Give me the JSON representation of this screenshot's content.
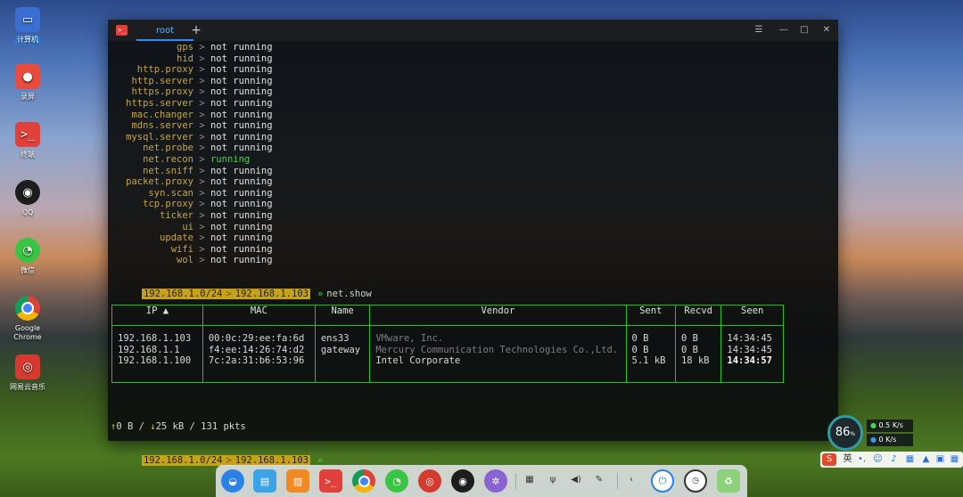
{
  "desktop": {
    "icons": [
      {
        "label": "计算机",
        "icon": "computer-icon",
        "color": "#3a6fd2"
      },
      {
        "label": "录屏",
        "icon": "screen-recorder-icon",
        "color": "#e94b3c"
      },
      {
        "label": "终端",
        "icon": "terminal-icon",
        "color": "#e0413a"
      },
      {
        "label": "QQ",
        "icon": "qq-penguin-icon",
        "color": "#1d1d1d"
      },
      {
        "label": "微信",
        "icon": "wechat-icon",
        "color": "#39c443"
      },
      {
        "label": "Google Chrome",
        "icon": "chrome-icon",
        "color": "#db4437"
      },
      {
        "label": "网易云音乐",
        "icon": "netease-music-icon",
        "color": "#d53a2f"
      }
    ]
  },
  "window": {
    "tab_label": "root",
    "new_tab_symbol": "+",
    "controls": {
      "menu": "☰",
      "minimize": "—",
      "maximize": "□",
      "close": "✕"
    }
  },
  "terminal": {
    "modules": [
      {
        "name": "gps",
        "status": "not running"
      },
      {
        "name": "hid",
        "status": "not running"
      },
      {
        "name": "http.proxy",
        "status": "not running"
      },
      {
        "name": "http.server",
        "status": "not running"
      },
      {
        "name": "https.proxy",
        "status": "not running"
      },
      {
        "name": "https.server",
        "status": "not running"
      },
      {
        "name": "mac.changer",
        "status": "not running"
      },
      {
        "name": "mdns.server",
        "status": "not running"
      },
      {
        "name": "mysql.server",
        "status": "not running"
      },
      {
        "name": "net.probe",
        "status": "not running"
      },
      {
        "name": "net.recon",
        "status": "running"
      },
      {
        "name": "net.sniff",
        "status": "not running"
      },
      {
        "name": "packet.proxy",
        "status": "not running"
      },
      {
        "name": "syn.scan",
        "status": "not running"
      },
      {
        "name": "tcp.proxy",
        "status": "not running"
      },
      {
        "name": "ticker",
        "status": "not running"
      },
      {
        "name": "ui",
        "status": "not running"
      },
      {
        "name": "update",
        "status": "not running"
      },
      {
        "name": "wifi",
        "status": "not running"
      },
      {
        "name": "wol",
        "status": "not running"
      }
    ],
    "separator": ">",
    "prompt_subnet": "192.168.1.0/24",
    "prompt_ip": "192.168.1.103",
    "prompt_arrow": "»",
    "command": "net.show",
    "table": {
      "headers": [
        "IP ▲",
        "MAC",
        "Name",
        "Vendor",
        "Sent",
        "Recvd",
        "Seen"
      ],
      "rows": [
        {
          "ip": "192.168.1.103",
          "mac": "00:0c:29:ee:fa:6d",
          "name": "ens33",
          "vendor": "VMware, Inc.",
          "sent": "0 B",
          "recvd": "0 B",
          "seen": "14:34:45"
        },
        {
          "ip": "192.168.1.1",
          "mac": "f4:ee:14:26:74:d2",
          "name": "gateway",
          "vendor": "Mercury Communication Technologies Co.,Ltd.",
          "sent": "0 B",
          "recvd": "0 B",
          "seen": "14:34:45"
        },
        {
          "ip": "192.168.1.100",
          "mac": "7c:2a:31:b6:53:96",
          "name": "",
          "vendor": "Intel Corporate",
          "sent": "5.1 kB",
          "recvd": "18 kB",
          "seen": "14:34:57"
        }
      ]
    },
    "stats": {
      "up_arrow": "↑",
      "sent": "0 B",
      "down_arrow": "↓",
      "received": "25 kB",
      "packets": "131 pkts"
    }
  },
  "dock": {
    "apps": [
      {
        "icon": "launcher-icon",
        "color": "#2a82e4"
      },
      {
        "icon": "file-manager-icon",
        "color": "#3ba3e6"
      },
      {
        "icon": "app-store-icon",
        "color": "#f08a24"
      },
      {
        "icon": "terminal-icon",
        "color": "#e0413a"
      },
      {
        "icon": "chrome-icon",
        "color": "#db4437"
      },
      {
        "icon": "wechat-icon",
        "color": "#39c443"
      },
      {
        "icon": "netease-music-icon",
        "color": "#d53a2f"
      },
      {
        "icon": "qq-penguin-icon",
        "color": "#1d1d1d"
      },
      {
        "icon": "settings-icon",
        "color": "#8a63d2"
      }
    ]
  },
  "netmeter": {
    "percent": "86",
    "percent_unit": "%",
    "up": "0.5",
    "down": "0",
    "unit": "K/s"
  },
  "ime": {
    "lang": "英"
  }
}
